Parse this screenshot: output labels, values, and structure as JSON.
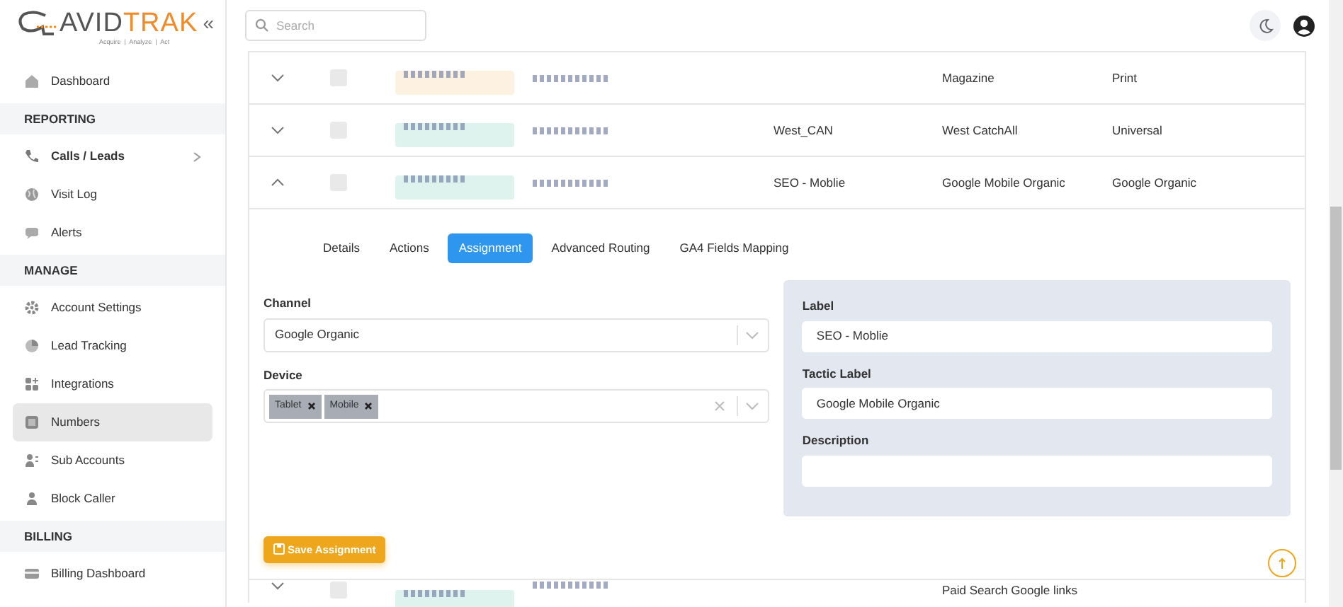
{
  "sidebar": {
    "logo": {
      "brand_main": "AVID",
      "brand_accent": "TRAK",
      "tagline": "Acquire  |  Analyze  |  Act"
    },
    "collapse": "«",
    "items": [
      {
        "kind": "item",
        "label": "Dashboard",
        "selected": false,
        "expandable": false
      },
      {
        "kind": "header",
        "label": "REPORTING"
      },
      {
        "kind": "item",
        "label": "Calls / Leads",
        "selected": false,
        "expandable": true
      },
      {
        "kind": "item",
        "label": "Visit Log",
        "selected": false,
        "expandable": false
      },
      {
        "kind": "item",
        "label": "Alerts",
        "selected": false,
        "expandable": false
      },
      {
        "kind": "header",
        "label": "MANAGE"
      },
      {
        "kind": "item",
        "label": "Account Settings",
        "selected": false,
        "expandable": false
      },
      {
        "kind": "item",
        "label": "Lead Tracking",
        "selected": false,
        "expandable": false
      },
      {
        "kind": "item",
        "label": "Integrations",
        "selected": false,
        "expandable": false
      },
      {
        "kind": "item",
        "label": "Numbers",
        "selected": true,
        "expandable": false
      },
      {
        "kind": "item",
        "label": "Sub Accounts",
        "selected": false,
        "expandable": false
      },
      {
        "kind": "item",
        "label": "Block Caller",
        "selected": false,
        "expandable": false
      },
      {
        "kind": "header",
        "label": "BILLING"
      },
      {
        "kind": "item",
        "label": "Billing Dashboard",
        "selected": false,
        "expandable": false
      }
    ]
  },
  "topbar": {
    "search": {
      "placeholder": "Search"
    }
  },
  "table": {
    "rows": [
      {
        "expanded": false,
        "checked": false,
        "color": "#fdf1e2",
        "column_6": "Magazine",
        "column_7": "Print"
      },
      {
        "expanded": false,
        "checked": false,
        "color": "#dff3ee",
        "column_5": "West_CAN",
        "column_6": "West CatchAll",
        "column_7": "Universal"
      },
      {
        "expanded": true,
        "checked": false,
        "color": "#dff3ee",
        "column_5": "SEO - Moblie",
        "column_6": "Google Mobile Organic",
        "column_7": "Google Organic"
      }
    ],
    "detail": {
      "tabs": [
        {
          "label": "Details",
          "selected": false
        },
        {
          "label": "Actions",
          "selected": false
        },
        {
          "label": "Assignment",
          "selected": true
        },
        {
          "label": "Advanced Routing",
          "selected": false
        },
        {
          "label": "GA4 Fields Mapping",
          "selected": false
        }
      ],
      "channel": {
        "label": "Channel",
        "value": "Google Organic"
      },
      "device": {
        "label": "Device",
        "chips": [
          "Tablet",
          "Mobile"
        ]
      },
      "panel": [
        {
          "label": "Label",
          "value": "SEO - Moblie"
        },
        {
          "label": "Tactic Label",
          "value": "Google Mobile Organic"
        },
        {
          "label": "Description"
        }
      ],
      "save_button": "Save Assignment"
    },
    "next_row": {
      "expanded": false,
      "checked": false,
      "color": "#dff3ee",
      "column_6": "Paid Search Google links"
    }
  }
}
